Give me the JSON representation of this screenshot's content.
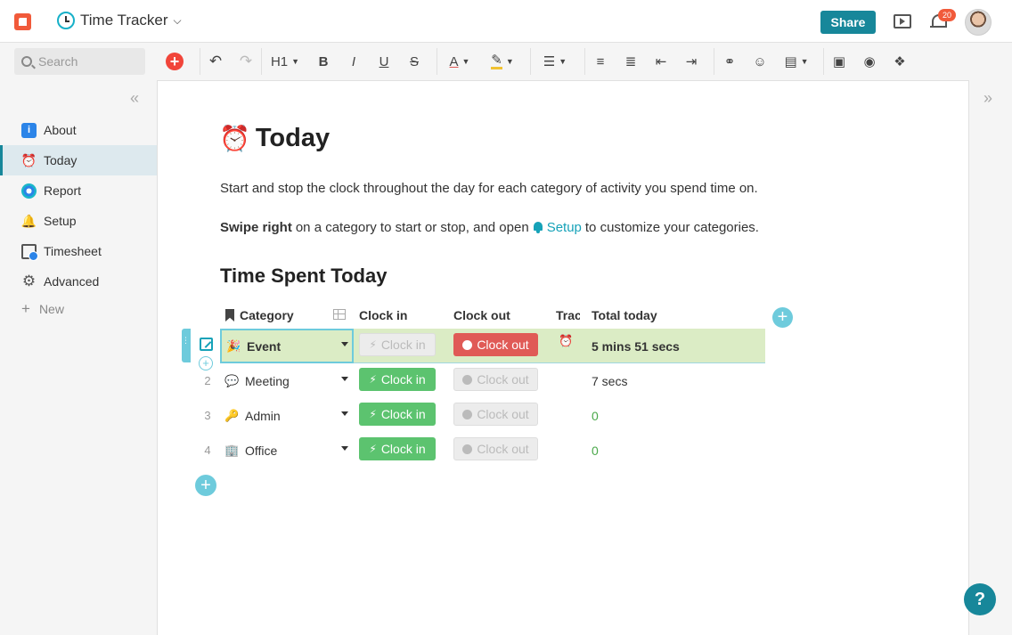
{
  "app": {
    "doc_title": "Time Tracker",
    "share_label": "Share",
    "notification_count": "20"
  },
  "search": {
    "placeholder": "Search"
  },
  "toolbar": {
    "heading_label": "H1",
    "bold": "B",
    "italic": "I",
    "underline": "U",
    "strike": "S",
    "text_color": "A",
    "add_symbol": "+"
  },
  "sidebar": {
    "items": [
      {
        "label": "About",
        "icon": "info-icon"
      },
      {
        "label": "Today",
        "icon": "alarm-clock-icon",
        "active": true
      },
      {
        "label": "Report",
        "icon": "report-icon"
      },
      {
        "label": "Setup",
        "icon": "bell-icon"
      },
      {
        "label": "Timesheet",
        "icon": "timesheet-icon"
      },
      {
        "label": "Advanced",
        "icon": "gear-icon"
      }
    ],
    "new_label": "New"
  },
  "page": {
    "emoji": "⏰",
    "title": "Today",
    "intro": "Start and stop the clock throughout the day for each category of activity you spend time on.",
    "swipe_bold": "Swipe right",
    "swipe_text": "on a category to start or stop, and open",
    "setup_link": "Setup",
    "swipe_tail": "to customize your categories.",
    "section_title": "Time Spent Today"
  },
  "table": {
    "columns": {
      "category": "Category",
      "clock_in": "Clock in",
      "clock_out": "Clock out",
      "tracking": "Tracking",
      "total": "Total today"
    },
    "rows": [
      {
        "num": "",
        "emoji": "🎉",
        "category": "Event",
        "clock_in": "Clock in",
        "clock_in_enabled": false,
        "clock_out": "Clock out",
        "clock_out_enabled": true,
        "tracking": "⏰",
        "total": "5 mins 51 secs"
      },
      {
        "num": "2",
        "emoji": "💬",
        "category": "Meeting",
        "clock_in": "Clock in",
        "clock_in_enabled": true,
        "clock_out": "Clock out",
        "clock_out_enabled": false,
        "tracking": "",
        "total": "7 secs"
      },
      {
        "num": "3",
        "emoji": "🔑",
        "category": "Admin",
        "clock_in": "Clock in",
        "clock_in_enabled": true,
        "clock_out": "Clock out",
        "clock_out_enabled": false,
        "tracking": "",
        "total": "0"
      },
      {
        "num": "4",
        "emoji": "🏢",
        "category": "Office",
        "clock_in": "Clock in",
        "clock_in_enabled": true,
        "clock_out": "Clock out",
        "clock_out_enabled": false,
        "tracking": "",
        "total": "0"
      }
    ]
  },
  "help_label": "?",
  "colors": {
    "accent": "#17879a",
    "brand": "#f15a3a",
    "clock_in": "#5cc36f",
    "clock_out": "#e05a56",
    "selected_row": "#dbecc5"
  }
}
